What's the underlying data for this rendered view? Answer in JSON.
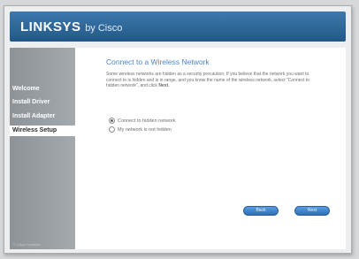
{
  "header": {
    "logo_main": "LINKSYS",
    "logo_sub": "by Cisco"
  },
  "sidebar": {
    "items": [
      {
        "label": "Welcome"
      },
      {
        "label": "Install Driver"
      },
      {
        "label": "Install Adapter"
      },
      {
        "label": "Wireless Setup"
      }
    ],
    "active_index": 3,
    "copyright": "© Cisco Systems"
  },
  "main": {
    "title": "Connect to a Wireless Network",
    "description_start": "Some wireless networks are hidden as a security precaution. If you believe that the network you want to connect to is hidden and is in range, and you know the name of the wireless network, select \"Connect to hidden network\", and click ",
    "description_bold": "Next",
    "description_end": ".",
    "options": [
      {
        "label": "Connect to hidden network",
        "selected": true
      },
      {
        "label": "My network is not hidden",
        "selected": false
      }
    ]
  },
  "buttons": {
    "back": "Back",
    "next": "Next"
  },
  "colors": {
    "header_blue": "#2d66a0",
    "title_blue": "#4a87c4",
    "button_blue": "#3d84c8"
  }
}
